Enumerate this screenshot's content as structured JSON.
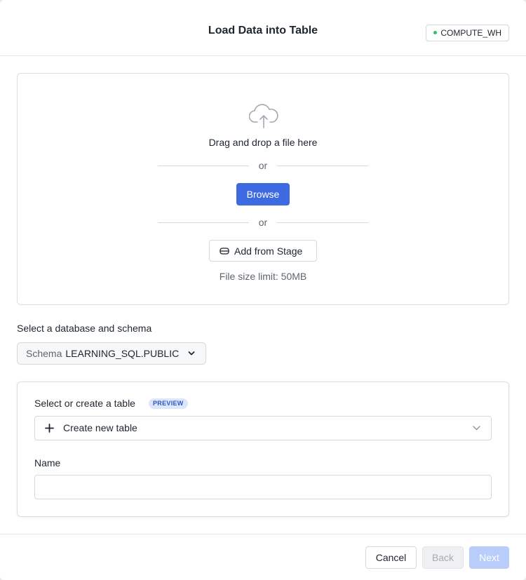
{
  "header": {
    "title": "Load Data into Table",
    "warehouse": "COMPUTE_WH",
    "warehouse_status_color": "#2fbf71"
  },
  "dropzone": {
    "icon": "cloud-upload-icon",
    "drag_text": "Drag and drop a file here",
    "or_1": "or",
    "browse_label": "Browse",
    "or_2": "or",
    "stage_icon": "stage-icon",
    "stage_label": "Add from Stage",
    "size_limit": "File size limit: 50MB"
  },
  "schema": {
    "label": "Select a database and schema",
    "prefix": "Schema",
    "value": "LEARNING_SQL.PUBLIC"
  },
  "table": {
    "label": "Select or create a table",
    "badge": "PREVIEW",
    "selected": "Create new table",
    "name_label": "Name",
    "name_value": "",
    "name_placeholder": ""
  },
  "footer": {
    "cancel": "Cancel",
    "back": "Back",
    "next": "Next"
  },
  "colors": {
    "accent": "#3e6ae1",
    "next_disabled": "#b9cdfa"
  }
}
